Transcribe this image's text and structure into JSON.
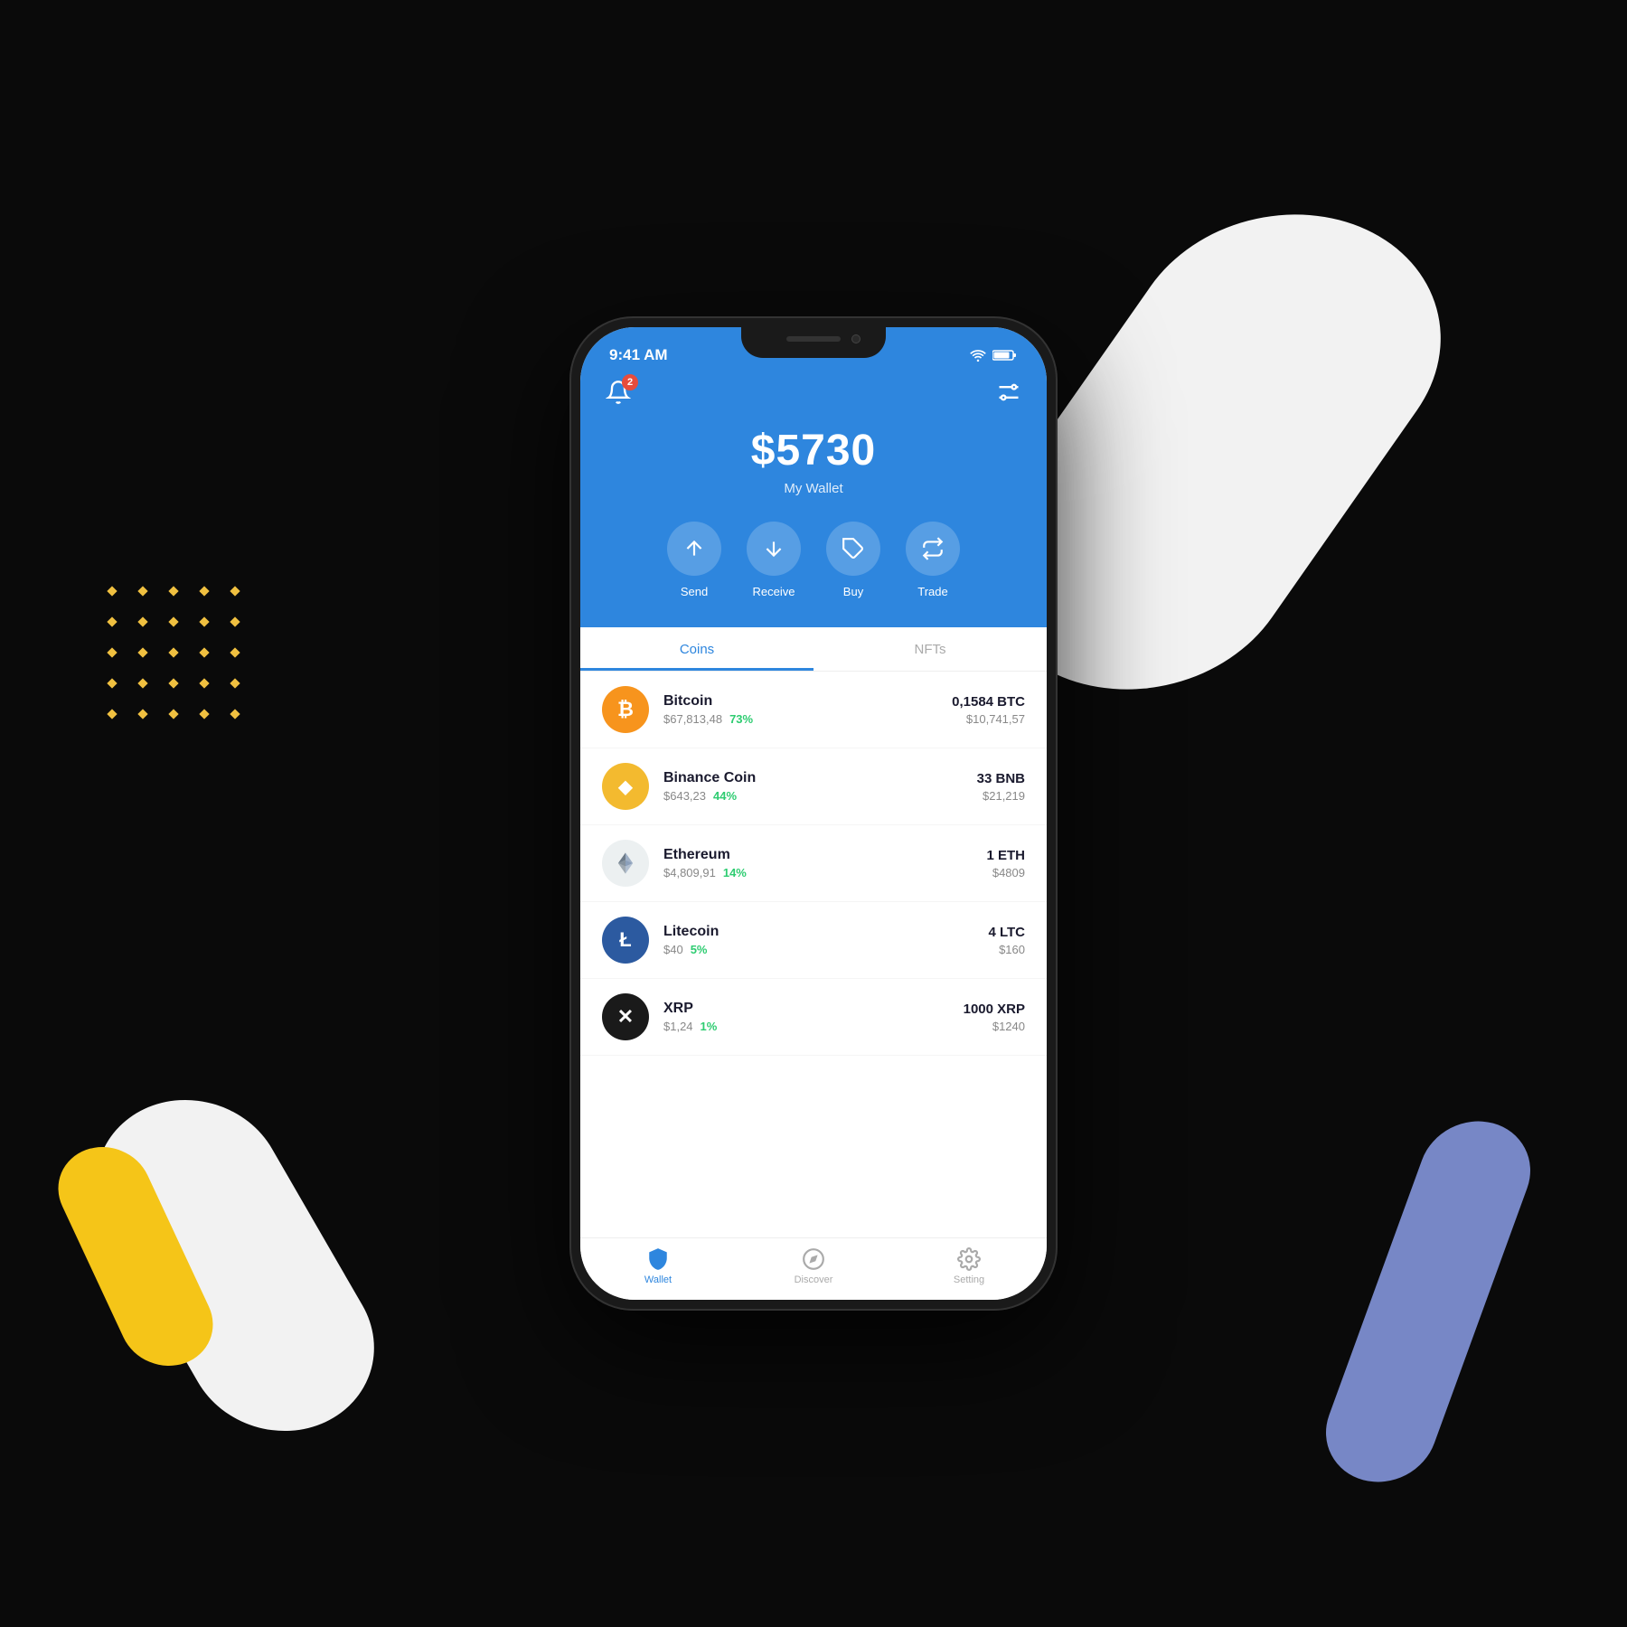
{
  "background": "#0a0a0a",
  "status_bar": {
    "time": "9:41 AM",
    "wifi": true,
    "battery": true
  },
  "header": {
    "notification_badge": "2",
    "wallet_amount": "$5730",
    "wallet_label": "My Wallet"
  },
  "actions": [
    {
      "id": "send",
      "label": "Send"
    },
    {
      "id": "receive",
      "label": "Receive"
    },
    {
      "id": "buy",
      "label": "Buy"
    },
    {
      "id": "trade",
      "label": "Trade"
    }
  ],
  "tabs": [
    {
      "id": "coins",
      "label": "Coins",
      "active": true
    },
    {
      "id": "nfts",
      "label": "NFTs",
      "active": false
    }
  ],
  "coins": [
    {
      "id": "btc",
      "name": "Bitcoin",
      "price": "$67,813,48",
      "pct": "73%",
      "amount": "0,1584 BTC",
      "value": "$10,741,57",
      "bg": "#f7941d",
      "symbol": "₿"
    },
    {
      "id": "bnb",
      "name": "Binance Coin",
      "price": "$643,23",
      "pct": "44%",
      "amount": "33 BNB",
      "value": "$21,219",
      "bg": "#f3ba2f",
      "symbol": "◆"
    },
    {
      "id": "eth",
      "name": "Ethereum",
      "price": "$4,809,91",
      "pct": "14%",
      "amount": "1 ETH",
      "value": "$4809",
      "bg": "#ecf0f1",
      "symbol": "◈"
    },
    {
      "id": "ltc",
      "name": "Litecoin",
      "price": "$40",
      "pct": "5%",
      "amount": "4 LTC",
      "value": "$160",
      "bg": "#2c5aa0",
      "symbol": "Ł"
    },
    {
      "id": "xrp",
      "name": "XRP",
      "price": "$1,24",
      "pct": "1%",
      "amount": "1000 XRP",
      "value": "$1240",
      "bg": "#1a1a1a",
      "symbol": "✕"
    }
  ],
  "bottom_nav": [
    {
      "id": "wallet",
      "label": "Wallet",
      "active": true,
      "icon": "🛡"
    },
    {
      "id": "discover",
      "label": "Discover",
      "active": false,
      "icon": "🧭"
    },
    {
      "id": "setting",
      "label": "Setting",
      "active": false,
      "icon": "⚙"
    }
  ]
}
